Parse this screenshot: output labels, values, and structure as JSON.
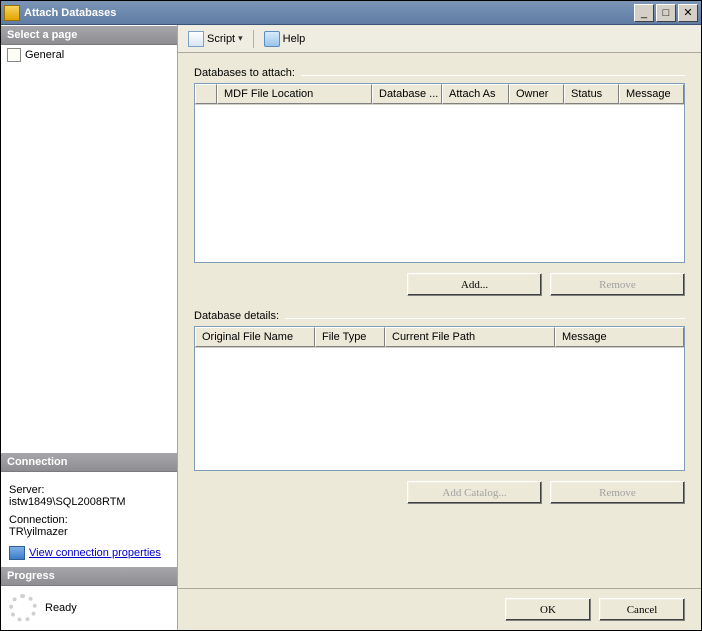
{
  "window": {
    "title": "Attach Databases"
  },
  "sidebar": {
    "selectPageHeader": "Select a page",
    "pages": [
      {
        "label": "General"
      }
    ],
    "connectionHeader": "Connection",
    "serverLabel": "Server:",
    "serverValue": "istw1849\\SQL2008RTM",
    "connectionLabel": "Connection:",
    "connectionValue": "TR\\yilmazer",
    "viewConnLink": "View connection properties",
    "progressHeader": "Progress",
    "progressStatus": "Ready"
  },
  "toolbar": {
    "script": "Script",
    "help": "Help"
  },
  "main": {
    "attachLabel": "Databases to attach:",
    "attachColumns": {
      "c1": "MDF File Location",
      "c2": "Database ...",
      "c3": "Attach As",
      "c4": "Owner",
      "c5": "Status",
      "c6": "Message"
    },
    "addBtn": "Add...",
    "removeBtn": "Remove",
    "detailsLabel": "Database details:",
    "detailColumns": {
      "c1": "Original File Name",
      "c2": "File Type",
      "c3": "Current File Path",
      "c4": "Message"
    },
    "addCatalogBtn": "Add Catalog...",
    "remove2Btn": "Remove"
  },
  "footer": {
    "ok": "OK",
    "cancel": "Cancel"
  }
}
